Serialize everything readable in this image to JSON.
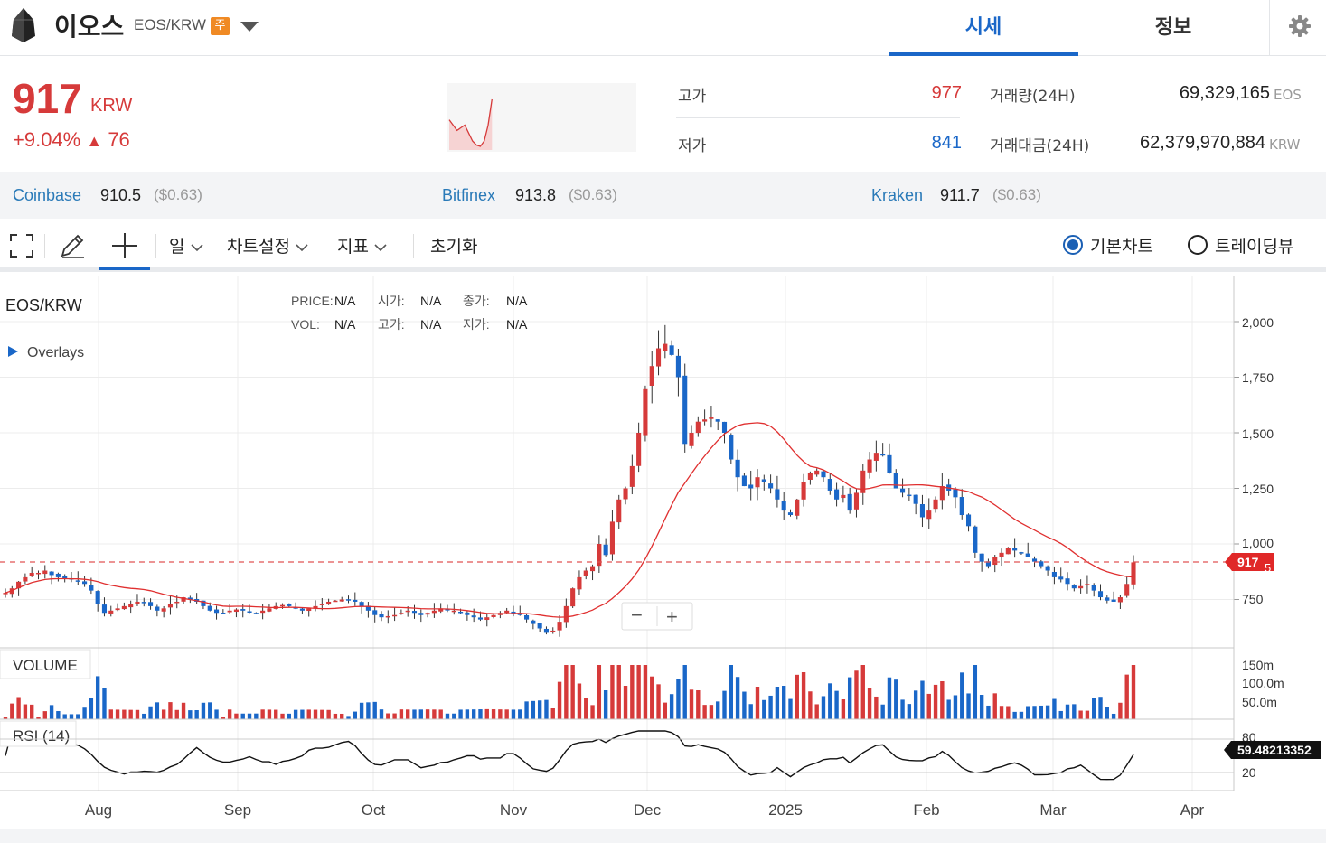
{
  "header": {
    "coin_name": "이오스",
    "pair": "EOS/KRW",
    "warning_badge": "주",
    "tabs": [
      {
        "label": "시세",
        "active": true
      },
      {
        "label": "정보",
        "active": false
      }
    ]
  },
  "price": {
    "current": "917",
    "unit": "KRW",
    "change_pct": "+9.04%",
    "change_arrow": "▲",
    "change_abs": "76",
    "color_up": "#d63a3a",
    "color_down": "#1a67c8"
  },
  "stats": {
    "high_label": "고가",
    "high": "977",
    "low_label": "저가",
    "low": "841",
    "volume_label": "거래량(24H)",
    "volume": "69,329,165",
    "volume_unit": "EOS",
    "amount_label": "거래대금(24H)",
    "amount": "62,379,970,884",
    "amount_unit": "KRW"
  },
  "exchanges": [
    {
      "name": "Coinbase",
      "price": "910.5",
      "usd": "($0.63)"
    },
    {
      "name": "Bitfinex",
      "price": "913.8",
      "usd": "($0.63)"
    },
    {
      "name": "Kraken",
      "price": "911.7",
      "usd": "($0.63)"
    }
  ],
  "toolbar": {
    "period": "일",
    "chart_settings": "차트설정",
    "indicators": "지표",
    "reset": "초기화",
    "basic_chart": "기본차트",
    "tradingview": "트레이딩뷰"
  },
  "chart": {
    "symbol": "EOS/KRW",
    "overlays_label": "Overlays",
    "info": {
      "price_label": "PRICE:",
      "price": "N/A",
      "open_label": "시가:",
      "open": "N/A",
      "close_label": "종가:",
      "close": "N/A",
      "vol_label": "VOL:",
      "vol": "N/A",
      "high_label": "고가:",
      "high": "N/A",
      "low_label": "저가:",
      "low": "N/A"
    },
    "price_ticks": [
      "2,000",
      "1,750",
      "1,500",
      "1,250",
      "1,000",
      "750"
    ],
    "current_price_tag": "917",
    "current_price_tag_suffix": "5",
    "volume_label": "VOLUME",
    "volume_ticks": [
      "150m",
      "100.0m",
      "50.0m"
    ],
    "rsi_label": "RSI (14)",
    "rsi_ticks": [
      "80",
      "20"
    ],
    "rsi_value_tag": "59.48213352",
    "x_ticks": [
      "Aug",
      "Sep",
      "Oct",
      "Nov",
      "Dec",
      "2025",
      "Feb",
      "Mar",
      "Apr"
    ],
    "zoom_out": "−",
    "zoom_in": "+"
  },
  "chart_data": {
    "type": "candlestick",
    "pair": "EOS/KRW",
    "x_ticks": [
      "Aug",
      "Sep",
      "Oct",
      "Nov",
      "Dec",
      "2025",
      "Feb",
      "Mar",
      "Apr"
    ],
    "y_ticks": [
      750,
      1000,
      1250,
      1500,
      1750,
      2000
    ],
    "ylim": [
      570,
      2200
    ],
    "current_price": 917,
    "close_series": [
      780,
      800,
      830,
      850,
      870,
      870,
      880,
      860,
      850,
      845,
      840,
      835,
      820,
      790,
      730,
      690,
      700,
      710,
      720,
      730,
      740,
      735,
      720,
      700,
      710,
      730,
      740,
      760,
      750,
      740,
      720,
      700,
      690,
      690,
      700,
      705,
      700,
      695,
      690,
      700,
      710,
      720,
      725,
      720,
      710,
      700,
      710,
      720,
      730,
      740,
      745,
      750,
      748,
      740,
      720,
      700,
      680,
      670,
      675,
      680,
      690,
      700,
      690,
      680,
      690,
      700,
      710,
      705,
      700,
      690,
      680,
      670,
      660,
      670,
      680,
      690,
      700,
      690,
      680,
      660,
      640,
      620,
      600,
      610,
      650,
      720,
      800,
      850,
      880,
      900,
      1000,
      950,
      1100,
      1200,
      1250,
      1350,
      1500,
      1700,
      1800,
      1880,
      1900,
      1850,
      1750,
      1450,
      1500,
      1550,
      1560,
      1570,
      1550,
      1500,
      1380,
      1300,
      1260,
      1250,
      1300,
      1280,
      1250,
      1200,
      1150,
      1130,
      1200,
      1280,
      1320,
      1330,
      1300,
      1240,
      1200,
      1220,
      1150,
      1230,
      1330,
      1380,
      1410,
      1400,
      1320,
      1250,
      1230,
      1220,
      1180,
      1120,
      1150,
      1200,
      1260,
      1240,
      1210,
      1130,
      1080,
      960,
      920,
      900,
      940,
      960,
      980,
      970,
      960,
      940,
      920,
      900,
      880,
      850,
      840,
      820,
      800,
      810,
      820,
      790,
      760,
      745,
      740,
      760,
      820,
      917
    ]
  }
}
